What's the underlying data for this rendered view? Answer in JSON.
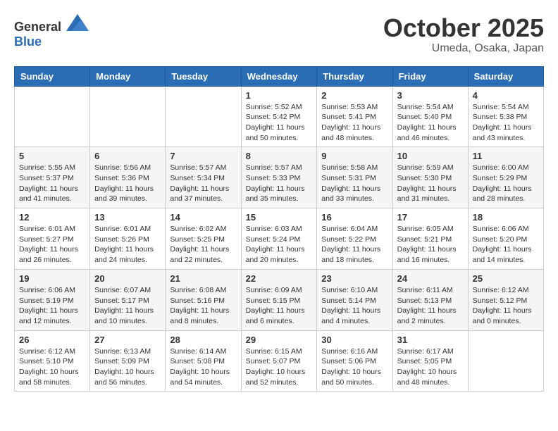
{
  "header": {
    "logo": {
      "text_general": "General",
      "text_blue": "Blue"
    },
    "title": "October 2025",
    "location": "Umeda, Osaka, Japan"
  },
  "weekdays": [
    "Sunday",
    "Monday",
    "Tuesday",
    "Wednesday",
    "Thursday",
    "Friday",
    "Saturday"
  ],
  "weeks": [
    [
      {
        "day": "",
        "info": ""
      },
      {
        "day": "",
        "info": ""
      },
      {
        "day": "",
        "info": ""
      },
      {
        "day": "1",
        "info": "Sunrise: 5:52 AM\nSunset: 5:42 PM\nDaylight: 11 hours\nand 50 minutes."
      },
      {
        "day": "2",
        "info": "Sunrise: 5:53 AM\nSunset: 5:41 PM\nDaylight: 11 hours\nand 48 minutes."
      },
      {
        "day": "3",
        "info": "Sunrise: 5:54 AM\nSunset: 5:40 PM\nDaylight: 11 hours\nand 46 minutes."
      },
      {
        "day": "4",
        "info": "Sunrise: 5:54 AM\nSunset: 5:38 PM\nDaylight: 11 hours\nand 43 minutes."
      }
    ],
    [
      {
        "day": "5",
        "info": "Sunrise: 5:55 AM\nSunset: 5:37 PM\nDaylight: 11 hours\nand 41 minutes."
      },
      {
        "day": "6",
        "info": "Sunrise: 5:56 AM\nSunset: 5:36 PM\nDaylight: 11 hours\nand 39 minutes."
      },
      {
        "day": "7",
        "info": "Sunrise: 5:57 AM\nSunset: 5:34 PM\nDaylight: 11 hours\nand 37 minutes."
      },
      {
        "day": "8",
        "info": "Sunrise: 5:57 AM\nSunset: 5:33 PM\nDaylight: 11 hours\nand 35 minutes."
      },
      {
        "day": "9",
        "info": "Sunrise: 5:58 AM\nSunset: 5:31 PM\nDaylight: 11 hours\nand 33 minutes."
      },
      {
        "day": "10",
        "info": "Sunrise: 5:59 AM\nSunset: 5:30 PM\nDaylight: 11 hours\nand 31 minutes."
      },
      {
        "day": "11",
        "info": "Sunrise: 6:00 AM\nSunset: 5:29 PM\nDaylight: 11 hours\nand 28 minutes."
      }
    ],
    [
      {
        "day": "12",
        "info": "Sunrise: 6:01 AM\nSunset: 5:27 PM\nDaylight: 11 hours\nand 26 minutes."
      },
      {
        "day": "13",
        "info": "Sunrise: 6:01 AM\nSunset: 5:26 PM\nDaylight: 11 hours\nand 24 minutes."
      },
      {
        "day": "14",
        "info": "Sunrise: 6:02 AM\nSunset: 5:25 PM\nDaylight: 11 hours\nand 22 minutes."
      },
      {
        "day": "15",
        "info": "Sunrise: 6:03 AM\nSunset: 5:24 PM\nDaylight: 11 hours\nand 20 minutes."
      },
      {
        "day": "16",
        "info": "Sunrise: 6:04 AM\nSunset: 5:22 PM\nDaylight: 11 hours\nand 18 minutes."
      },
      {
        "day": "17",
        "info": "Sunrise: 6:05 AM\nSunset: 5:21 PM\nDaylight: 11 hours\nand 16 minutes."
      },
      {
        "day": "18",
        "info": "Sunrise: 6:06 AM\nSunset: 5:20 PM\nDaylight: 11 hours\nand 14 minutes."
      }
    ],
    [
      {
        "day": "19",
        "info": "Sunrise: 6:06 AM\nSunset: 5:19 PM\nDaylight: 11 hours\nand 12 minutes."
      },
      {
        "day": "20",
        "info": "Sunrise: 6:07 AM\nSunset: 5:17 PM\nDaylight: 11 hours\nand 10 minutes."
      },
      {
        "day": "21",
        "info": "Sunrise: 6:08 AM\nSunset: 5:16 PM\nDaylight: 11 hours\nand 8 minutes."
      },
      {
        "day": "22",
        "info": "Sunrise: 6:09 AM\nSunset: 5:15 PM\nDaylight: 11 hours\nand 6 minutes."
      },
      {
        "day": "23",
        "info": "Sunrise: 6:10 AM\nSunset: 5:14 PM\nDaylight: 11 hours\nand 4 minutes."
      },
      {
        "day": "24",
        "info": "Sunrise: 6:11 AM\nSunset: 5:13 PM\nDaylight: 11 hours\nand 2 minutes."
      },
      {
        "day": "25",
        "info": "Sunrise: 6:12 AM\nSunset: 5:12 PM\nDaylight: 11 hours\nand 0 minutes."
      }
    ],
    [
      {
        "day": "26",
        "info": "Sunrise: 6:12 AM\nSunset: 5:10 PM\nDaylight: 10 hours\nand 58 minutes."
      },
      {
        "day": "27",
        "info": "Sunrise: 6:13 AM\nSunset: 5:09 PM\nDaylight: 10 hours\nand 56 minutes."
      },
      {
        "day": "28",
        "info": "Sunrise: 6:14 AM\nSunset: 5:08 PM\nDaylight: 10 hours\nand 54 minutes."
      },
      {
        "day": "29",
        "info": "Sunrise: 6:15 AM\nSunset: 5:07 PM\nDaylight: 10 hours\nand 52 minutes."
      },
      {
        "day": "30",
        "info": "Sunrise: 6:16 AM\nSunset: 5:06 PM\nDaylight: 10 hours\nand 50 minutes."
      },
      {
        "day": "31",
        "info": "Sunrise: 6:17 AM\nSunset: 5:05 PM\nDaylight: 10 hours\nand 48 minutes."
      },
      {
        "day": "",
        "info": ""
      }
    ]
  ]
}
